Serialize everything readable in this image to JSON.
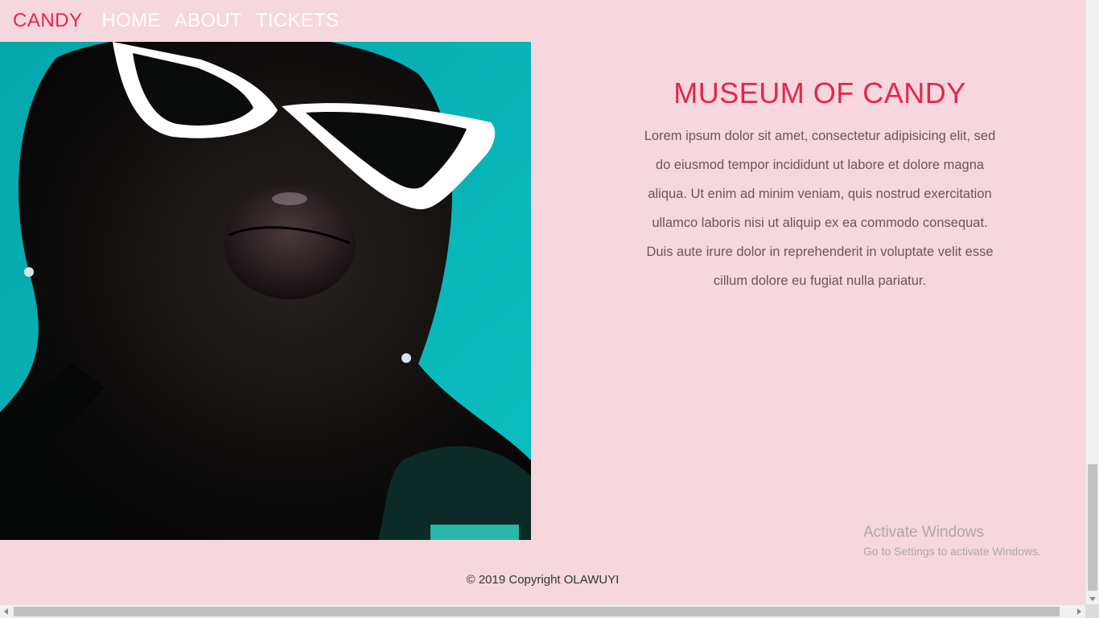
{
  "nav": {
    "brand": "CANDY",
    "links": [
      "HOME",
      "ABOUT",
      "TICKETS"
    ]
  },
  "hero": {
    "image_icon": "portrait-photo-icon"
  },
  "main": {
    "title": "MUSEUM OF CANDY",
    "body": "Lorem ipsum dolor sit amet, consectetur adipisicing elit, sed do eiusmod tempor incididunt ut labore et dolore magna aliqua. Ut enim ad minim veniam, quis nostrud exercitation ullamco laboris nisi ut aliquip ex ea commodo consequat. Duis aute irure dolor in reprehenderit in voluptate velit esse cillum dolore eu fugiat nulla pariatur."
  },
  "footer": {
    "copyright": "© 2019 Copyright OLAWUYI"
  },
  "watermark": {
    "title": "Activate Windows",
    "subtitle": "Go to Settings to activate Windows."
  },
  "colors": {
    "background": "#f6d7dd",
    "accent": "#e4264f",
    "nav_text": "#ffffff",
    "image_backdrop": "#06b3b8"
  }
}
